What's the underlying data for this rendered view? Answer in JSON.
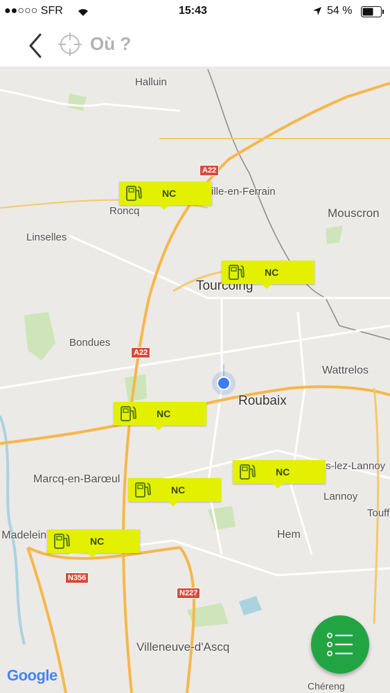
{
  "status_bar": {
    "carrier": "●●○○○ SFR",
    "time": "15:43",
    "battery": "54 %"
  },
  "nav": {
    "title": "Où ?"
  },
  "map": {
    "places": {
      "halluin": "Halluin",
      "neuville": "Neuville-en-Ferrain",
      "mouscron": "Mouscron",
      "roncq": "Roncq",
      "linselles": "Linselles",
      "tourcoing": "Tourcoing",
      "bondues": "Bondues",
      "wattrelos": "Wattrelos",
      "roubaix": "Roubaix",
      "marcq": "Marcq-en-Barœul",
      "lys": "Lys-lez-Lannoy",
      "lannoy": "Lannoy",
      "toufflers": "Toufflers",
      "madeleine": "La Madeleine",
      "hem": "Hem",
      "villeneuve": "Villeneuve-d'Ascq",
      "chereng": "Chéreng"
    },
    "road_labels": {
      "a22_top": "A22",
      "a22_mid": "A22",
      "n356": "N356",
      "n227": "N227"
    },
    "attribution": "Google",
    "stations": [
      {
        "label": "NC",
        "icon": "fuel-pump-icon"
      },
      {
        "label": "NC",
        "icon": "fuel-pump-icon"
      },
      {
        "label": "NC",
        "icon": "fuel-pump-icon"
      },
      {
        "label": "NC",
        "icon": "fuel-pump-icon"
      },
      {
        "label": "NC",
        "icon": "fuel-pump-icon"
      },
      {
        "label": "NC",
        "icon": "fuel-pump-icon"
      }
    ]
  },
  "colors": {
    "marker": "#e3f000",
    "fab": "#23a443",
    "user_location": "#3d7cf2"
  }
}
